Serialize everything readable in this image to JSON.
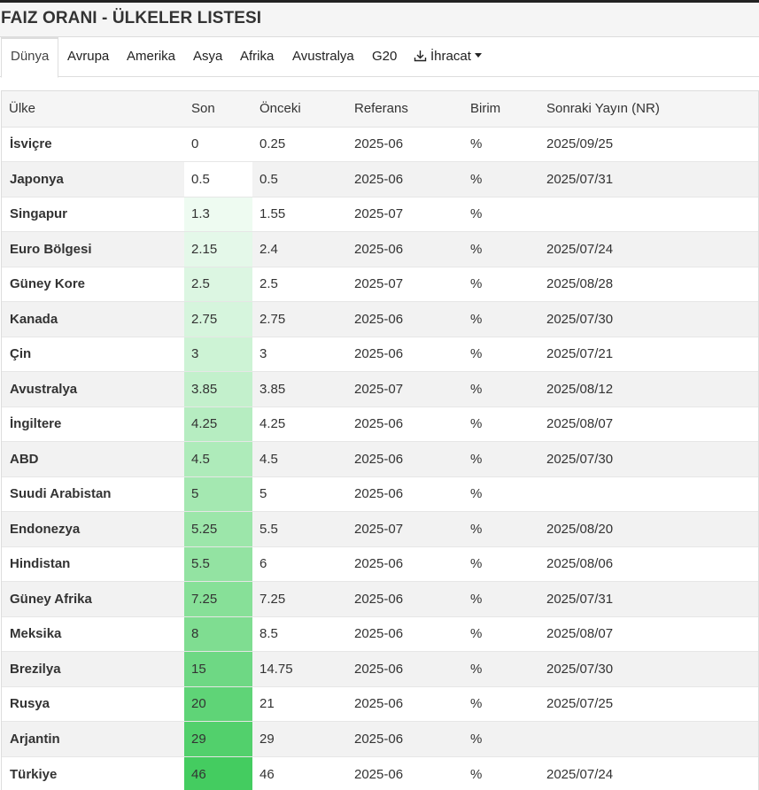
{
  "page": {
    "title": "FAIZ ORANI - ÜLKELER LISTESI"
  },
  "tabs": [
    {
      "label": "Dünya",
      "active": true
    },
    {
      "label": "Avrupa"
    },
    {
      "label": "Amerika"
    },
    {
      "label": "Asya"
    },
    {
      "label": "Afrika"
    },
    {
      "label": "Avustralya"
    },
    {
      "label": "G20"
    }
  ],
  "export": {
    "label": "İhracat",
    "icon": "download-icon"
  },
  "table": {
    "headers": [
      "Ülke",
      "Son",
      "Önceki",
      "Referans",
      "Birim",
      "Sonraki Yayın (NR)"
    ],
    "rows": [
      {
        "country": "İsviçre",
        "son": "0",
        "onceki": "0.25",
        "referans": "2025-06",
        "birim": "%",
        "sonraki": "2025/09/25",
        "heat": "#ffffff"
      },
      {
        "country": "Japonya",
        "son": "0.5",
        "onceki": "0.5",
        "referans": "2025-06",
        "birim": "%",
        "sonraki": "2025/07/31",
        "heat": "#ffffff"
      },
      {
        "country": "Singapur",
        "son": "1.3",
        "onceki": "1.55",
        "referans": "2025-07",
        "birim": "%",
        "sonraki": "",
        "heat": "#eefbf1"
      },
      {
        "country": "Euro Bölgesi",
        "son": "2.15",
        "onceki": "2.4",
        "referans": "2025-06",
        "birim": "%",
        "sonraki": "2025/07/24",
        "heat": "#e4f8e9"
      },
      {
        "country": "Güney Kore",
        "son": "2.5",
        "onceki": "2.5",
        "referans": "2025-07",
        "birim": "%",
        "sonraki": "2025/08/28",
        "heat": "#dcf6e2"
      },
      {
        "country": "Kanada",
        "son": "2.75",
        "onceki": "2.75",
        "referans": "2025-06",
        "birim": "%",
        "sonraki": "2025/07/30",
        "heat": "#d6f5dd"
      },
      {
        "country": "Çin",
        "son": "3",
        "onceki": "3",
        "referans": "2025-06",
        "birim": "%",
        "sonraki": "2025/07/21",
        "heat": "#cdf3d5"
      },
      {
        "country": "Avustralya",
        "son": "3.85",
        "onceki": "3.85",
        "referans": "2025-07",
        "birim": "%",
        "sonraki": "2025/08/12",
        "heat": "#c3f0cc"
      },
      {
        "country": "İngiltere",
        "son": "4.25",
        "onceki": "4.25",
        "referans": "2025-06",
        "birim": "%",
        "sonraki": "2025/08/07",
        "heat": "#b6edc1"
      },
      {
        "country": "ABD",
        "son": "4.5",
        "onceki": "4.5",
        "referans": "2025-06",
        "birim": "%",
        "sonraki": "2025/07/30",
        "heat": "#aeebba"
      },
      {
        "country": "Suudi Arabistan",
        "son": "5",
        "onceki": "5",
        "referans": "2025-06",
        "birim": "%",
        "sonraki": "",
        "heat": "#a4e8b1"
      },
      {
        "country": "Endonezya",
        "son": "5.25",
        "onceki": "5.5",
        "referans": "2025-07",
        "birim": "%",
        "sonraki": "2025/08/20",
        "heat": "#9ce6aa"
      },
      {
        "country": "Hindistan",
        "son": "5.5",
        "onceki": "6",
        "referans": "2025-06",
        "birim": "%",
        "sonraki": "2025/08/06",
        "heat": "#93e3a2"
      },
      {
        "country": "Güney Afrika",
        "son": "7.25",
        "onceki": "7.25",
        "referans": "2025-06",
        "birim": "%",
        "sonraki": "2025/07/31",
        "heat": "#87e098"
      },
      {
        "country": "Meksika",
        "son": "8",
        "onceki": "8.5",
        "referans": "2025-06",
        "birim": "%",
        "sonraki": "2025/08/07",
        "heat": "#7fdd91"
      },
      {
        "country": "Brezilya",
        "son": "15",
        "onceki": "14.75",
        "referans": "2025-06",
        "birim": "%",
        "sonraki": "2025/07/30",
        "heat": "#6ed884"
      },
      {
        "country": "Rusya",
        "son": "20",
        "onceki": "21",
        "referans": "2025-06",
        "birim": "%",
        "sonraki": "2025/07/25",
        "heat": "#5fd477"
      },
      {
        "country": "Arjantin",
        "son": "29",
        "onceki": "29",
        "referans": "2025-06",
        "birim": "%",
        "sonraki": "",
        "heat": "#52d06c"
      },
      {
        "country": "Türkiye",
        "son": "46",
        "onceki": "46",
        "referans": "2025-06",
        "birim": "%",
        "sonraki": "2025/07/24",
        "heat": "#44cc60"
      }
    ]
  }
}
